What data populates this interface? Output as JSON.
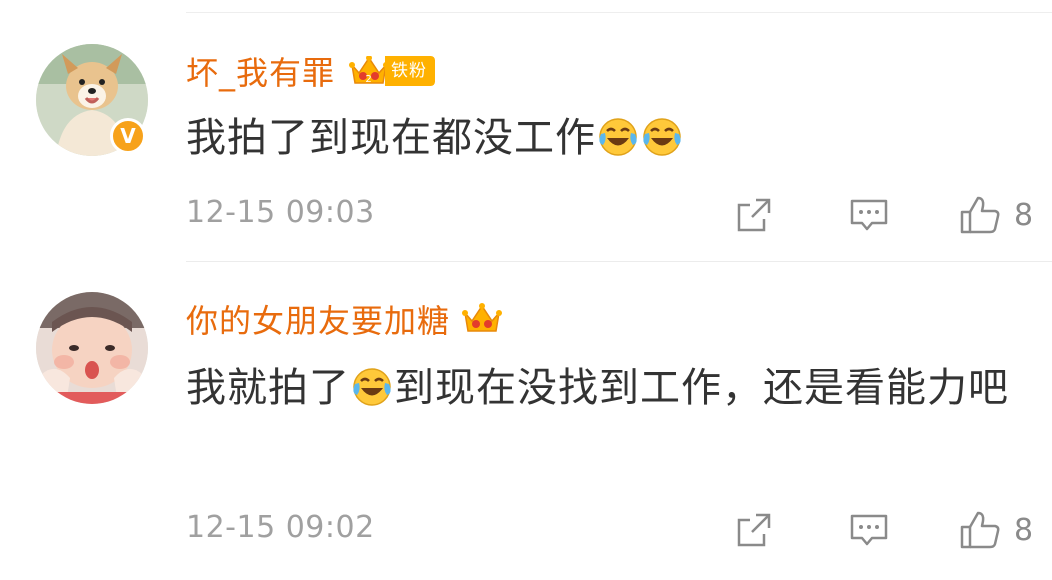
{
  "comments": [
    {
      "username": "坏_我有罪",
      "fan_badge": "铁粉",
      "verified": true,
      "text": "我拍了到现在都没工作",
      "trailing_emojis": [
        "laugh-cry-emoji",
        "laugh-cry-emoji"
      ],
      "timestamp": "12-15 09:03",
      "likes": "8"
    },
    {
      "username": "你的女朋友要加糖",
      "verified": false,
      "text_before_emoji": "我就拍了",
      "inline_emoji": "laugh-cry-emoji",
      "text_after_emoji": "到现在没找到工作，还是看能力吧",
      "timestamp": "12-15 09:02",
      "likes": "8"
    }
  ],
  "colors": {
    "username": "#e86b0d",
    "badge": "#ffb100",
    "meta": "#a0a0a0"
  },
  "icons": [
    "share-icon",
    "reply-icon",
    "thumbs-up-icon",
    "crown-icon",
    "verified-v-icon"
  ]
}
